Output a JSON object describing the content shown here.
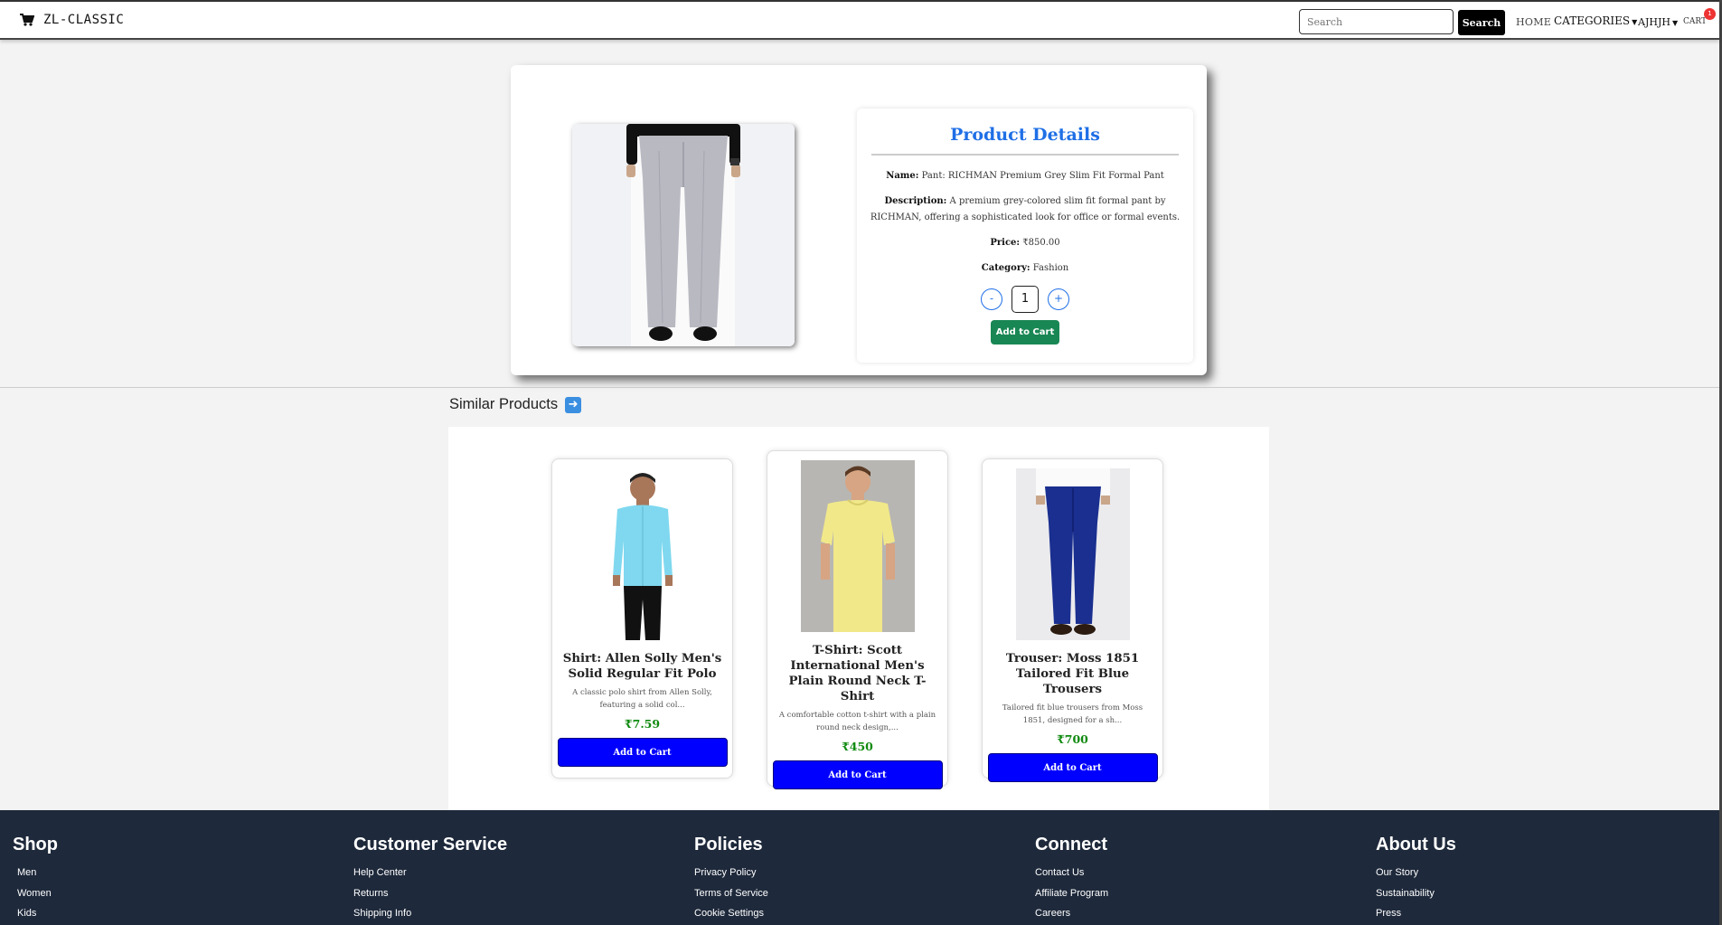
{
  "navbar": {
    "brand": "ZL-CLASSIC",
    "brand_icon": "shopping-cart-icon",
    "search_placeholder": "Search",
    "search_button": "Search",
    "home": "HOME",
    "categories": "CATEGORIES",
    "user": "AJHJH",
    "cart": "CART",
    "cart_count": "1"
  },
  "product": {
    "title": "Product Details",
    "name_label": "Name:",
    "name": "Pant: RICHMAN Premium Grey Slim Fit Formal Pant",
    "description_label": "Description:",
    "description": "A premium grey-colored slim fit formal pant by RICHMAN, offering a sophisticated look for office or formal events.",
    "price_label": "Price:",
    "price": "₹850.00",
    "category_label": "Category:",
    "category": "Fashion",
    "decrement": "-",
    "quantity": "1",
    "increment": "+",
    "add_to_cart": "Add to Cart"
  },
  "similar": {
    "title": "Similar Products",
    "title_icon": "arrow-right-icon",
    "items": [
      {
        "name": "Shirt: Allen Solly Men's Solid Regular Fit Polo",
        "description": "A classic polo shirt from Allen Solly, featuring a solid col...",
        "price": "₹7.59",
        "button": "Add to Cart"
      },
      {
        "name": "T-Shirt: Scott International Men's Plain Round Neck T-Shirt",
        "description": "A comfortable cotton t-shirt with a plain round neck design,...",
        "price": "₹450",
        "button": "Add to Cart"
      },
      {
        "name": "Trouser: Moss 1851 Tailored Fit Blue Trousers",
        "description": "Tailored fit blue trousers from Moss 1851, designed for a sh...",
        "price": "₹700",
        "button": "Add to Cart"
      }
    ]
  },
  "footer": {
    "columns": [
      {
        "heading": "Shop",
        "links": [
          "Men",
          "Women",
          "Kids"
        ]
      },
      {
        "heading": "Customer Service",
        "links": [
          "Help Center",
          "Returns",
          "Shipping Info"
        ]
      },
      {
        "heading": "Policies",
        "links": [
          "Privacy Policy",
          "Terms of Service",
          "Cookie Settings"
        ]
      },
      {
        "heading": "Connect",
        "links": [
          "Contact Us",
          "Affiliate Program",
          "Careers"
        ]
      },
      {
        "heading": "About Us",
        "links": [
          "Our Story",
          "Sustainability",
          "Press"
        ]
      }
    ]
  },
  "colors": {
    "accent_blue": "#1f6fe6",
    "add_green": "#198754",
    "add_blue": "#0000ff",
    "price_green": "#0f8a0f",
    "footer_bg": "#1e293b"
  }
}
